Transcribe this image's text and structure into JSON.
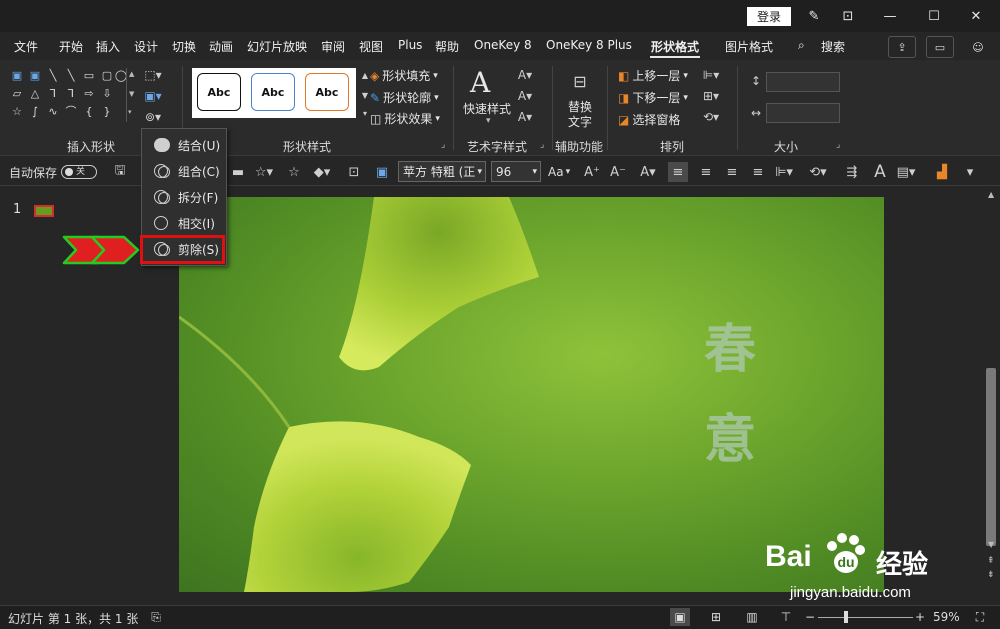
{
  "titlebar": {
    "login_label": "登录"
  },
  "menu": {
    "items": [
      "文件",
      "开始",
      "插入",
      "设计",
      "切换",
      "动画",
      "幻灯片放映",
      "审阅",
      "视图",
      "Plus",
      "帮助",
      "OneKey 8",
      "OneKey 8 Plus",
      "形状格式",
      "图片格式"
    ],
    "active": "形状格式",
    "search_label": "搜索"
  },
  "ribbon": {
    "groups": {
      "insert_shapes": "插入形状",
      "shape_styles": "形状样式",
      "art_text": "艺术字样式",
      "accessibility": "辅助功能",
      "arrange": "排列",
      "size": "大小"
    },
    "style_sample": "Abc",
    "shape_fill": "形状填充",
    "shape_outline": "形状轮廓",
    "shape_effect": "形状效果",
    "quick_style": "快速样式",
    "alt_text_line1": "替换",
    "alt_text_line2": "文字",
    "bring_forward": "上移一层",
    "send_backward": "下移一层",
    "selection_pane": "选择窗格"
  },
  "qat": {
    "autosave": "自动保存",
    "autosave_state": "关",
    "font_name": "苹方 特粗 (正",
    "font_size": "96",
    "font_case": "Aa"
  },
  "dropdown": {
    "items": [
      "结合(U)",
      "组合(C)",
      "拆分(F)",
      "相交(I)",
      "剪除(S)"
    ],
    "highlighted": "剪除(S)"
  },
  "slides": {
    "current_number": "1"
  },
  "slide_content": {
    "char1": "春",
    "char2": "意"
  },
  "watermark": {
    "brand": "Bai",
    "brand_suffix": "经验",
    "url": "jingyan.baidu.com"
  },
  "statusbar": {
    "text": "幻灯片 第 1 张，共 1 张",
    "zoom": "59%"
  },
  "colors": {
    "highlight": "#e01010",
    "arrow_fill": "#e02020",
    "arrow_outline": "#22cc22"
  }
}
